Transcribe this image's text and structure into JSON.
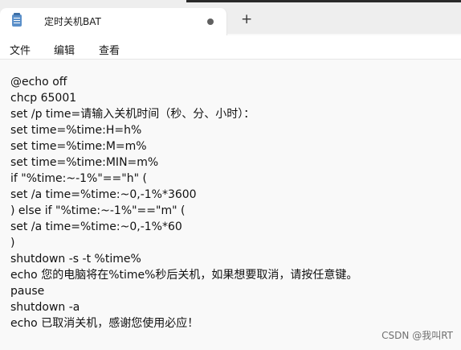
{
  "tab": {
    "icon": "notepad-icon",
    "title": "定时关机BAT",
    "dot_icon": "unsaved-dot-icon",
    "new_tab_icon": "plus-icon",
    "new_tab_symbol": "+"
  },
  "menu": {
    "items": [
      "文件",
      "编辑",
      "查看"
    ]
  },
  "editor": {
    "lines": [
      "@echo off",
      "chcp 65001",
      "set /p time=请输入关机时间（秒、分、小时）：",
      "set time=%time:H=h%",
      "set time=%time:M=m%",
      "set time=%time:MIN=m%",
      "if \"%time:~-1%\"==\"h\" (",
      "set /a time=%time:~0,-1%*3600",
      ") else if \"%time:~-1%\"==\"m\" (",
      "set /a time=%time:~0,-1%*60",
      ")",
      "shutdown -s -t %time%",
      "echo 您的电脑将在%time%秒后关机，如果想要取消，请按任意键。",
      "pause",
      "shutdown -a",
      "echo 已取消关机，感谢您使用必应！"
    ]
  },
  "watermark": "CSDN @我叫RT"
}
